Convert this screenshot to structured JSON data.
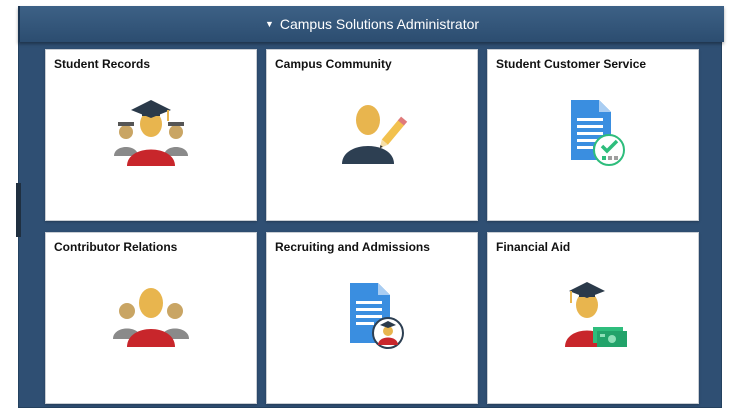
{
  "header": {
    "title": "Campus Solutions Administrator"
  },
  "tiles": [
    {
      "label": "Student Records",
      "icon": "graduate-group-icon"
    },
    {
      "label": "Campus Community",
      "icon": "person-pencil-icon"
    },
    {
      "label": "Student Customer Service",
      "icon": "document-checkmark-icon"
    },
    {
      "label": "Contributor Relations",
      "icon": "person-group-icon"
    },
    {
      "label": "Recruiting and Admissions",
      "icon": "document-graduate-icon"
    },
    {
      "label": "Financial Aid",
      "icon": "graduate-money-icon"
    }
  ],
  "colors": {
    "banner": "#2f4f73",
    "tile_bg": "#ffffff",
    "accent_blue": "#3a8ee0",
    "accent_red": "#c8262b",
    "accent_green": "#2ebd7c"
  }
}
